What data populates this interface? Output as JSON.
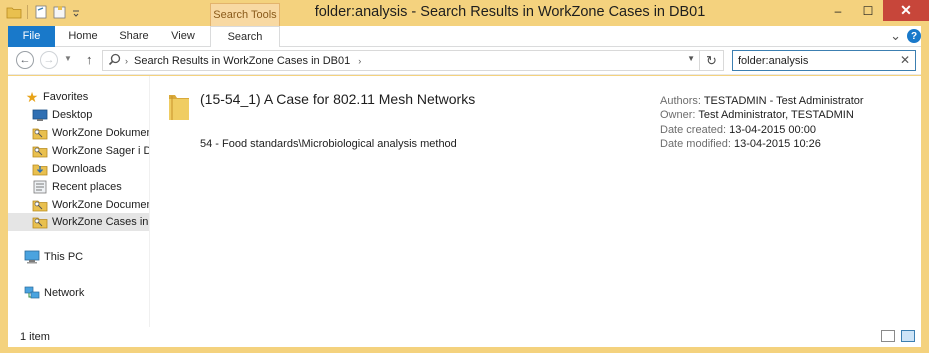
{
  "window": {
    "title": "folder:analysis - Search Results in WorkZone Cases in DB01",
    "context_tab_header": "Search Tools",
    "controls": {
      "minimize": "–",
      "maximize": "☐",
      "close": "✕"
    }
  },
  "ribbon": {
    "tabs": [
      {
        "label": "File"
      },
      {
        "label": "Home"
      },
      {
        "label": "Share"
      },
      {
        "label": "View"
      },
      {
        "label": "Search"
      }
    ],
    "collapse_glyph": "⌄",
    "help_glyph": "?"
  },
  "address_bar": {
    "path": "Search Results in WorkZone Cases in DB01",
    "chevron": "›"
  },
  "search": {
    "value": "folder:analysis",
    "clear_glyph": "✕"
  },
  "nav_pane": {
    "favorites_label": "Favorites",
    "favorites": [
      {
        "label": "Desktop",
        "icon": "desktop-icon"
      },
      {
        "label": "WorkZone Dokumen",
        "icon": "workzone-folder-icon"
      },
      {
        "label": "WorkZone Sager i DB",
        "icon": "workzone-folder-icon"
      },
      {
        "label": "Downloads",
        "icon": "downloads-icon"
      },
      {
        "label": "Recent places",
        "icon": "recent-places-icon"
      },
      {
        "label": "WorkZone Documen",
        "icon": "workzone-folder-icon"
      },
      {
        "label": "WorkZone Cases in D",
        "icon": "workzone-folder-icon",
        "selected": true
      }
    ],
    "this_pc_label": "This PC",
    "network_label": "Network"
  },
  "results": [
    {
      "title": "(15-54_1) A Case for 802.11 Mesh Networks",
      "path": "54 - Food standards\\Microbiological analysis method",
      "authors_key": "Authors:",
      "authors": "TESTADMIN - Test Administrator",
      "owner_key": "Owner:",
      "owner": "Test Administrator, TESTADMIN",
      "created_key": "Date created:",
      "created": "13-04-2015 00:00",
      "modified_key": "Date modified:",
      "modified": "13-04-2015 10:26"
    }
  ],
  "status_bar": {
    "item_count": "1 item"
  },
  "colors": {
    "title_bar": "#f4d27e",
    "file_tab": "#1979ca",
    "close_button": "#c7463a",
    "folder": "#e9c04f"
  }
}
